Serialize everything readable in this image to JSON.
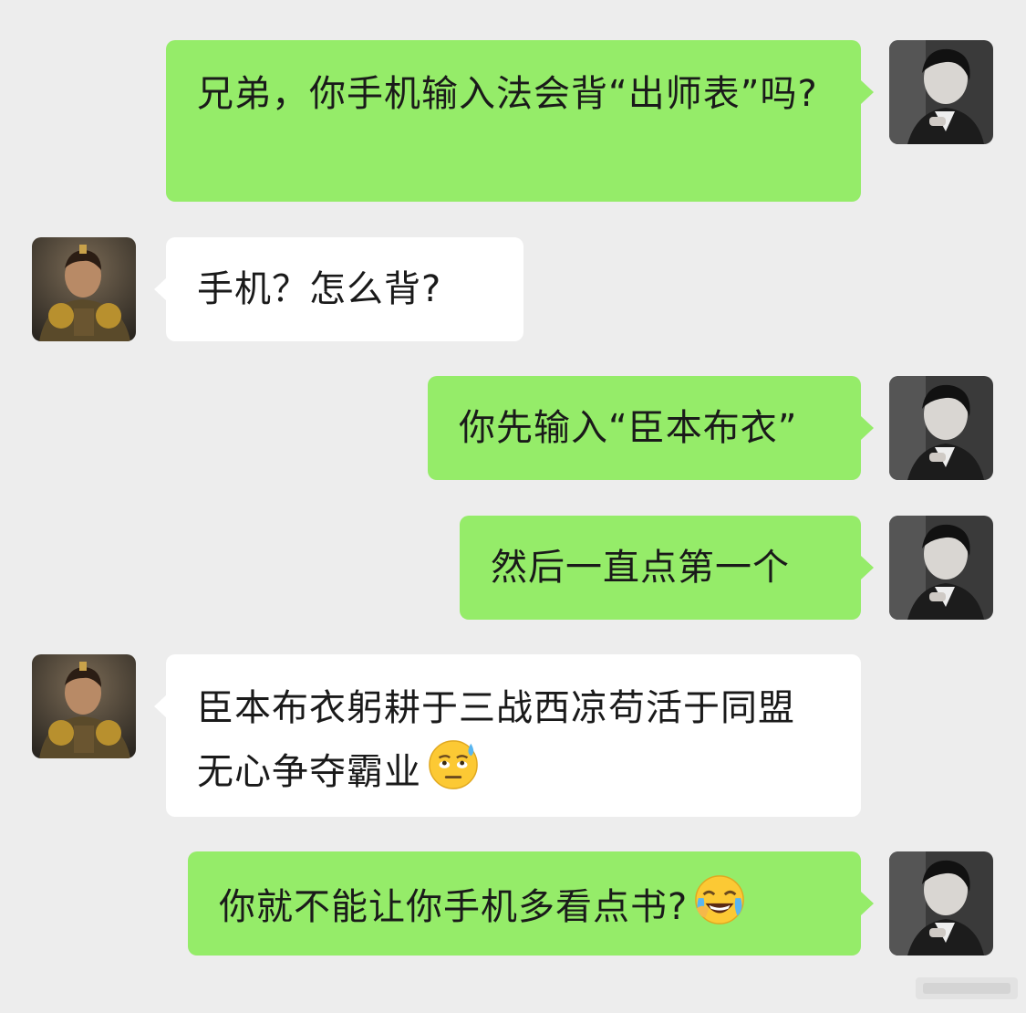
{
  "messages": [
    {
      "side": "sent",
      "text": "兄弟，你手机输入法会背“出师表”吗?"
    },
    {
      "side": "recv",
      "text": "手机？怎么背?"
    },
    {
      "side": "sent",
      "text": "你先输入“臣本布衣”"
    },
    {
      "side": "sent",
      "text": "然后一直点第一个"
    },
    {
      "side": "recv",
      "text": "臣本布衣躬耕于三战西凉苟活于同盟无心争夺霸业",
      "emoji": "sweat-rolling-eyes-emoji"
    },
    {
      "side": "sent",
      "text": "你就不能让你手机多看点书?",
      "emoji": "laughing-crying-emoji"
    }
  ],
  "avatars": {
    "self": "avatar-self-monochrome-portrait",
    "other": "avatar-warrior-general"
  },
  "colors": {
    "background": "#ededed",
    "sent_bubble": "#95ec69",
    "recv_bubble": "#ffffff",
    "text": "#1a1a1a"
  }
}
